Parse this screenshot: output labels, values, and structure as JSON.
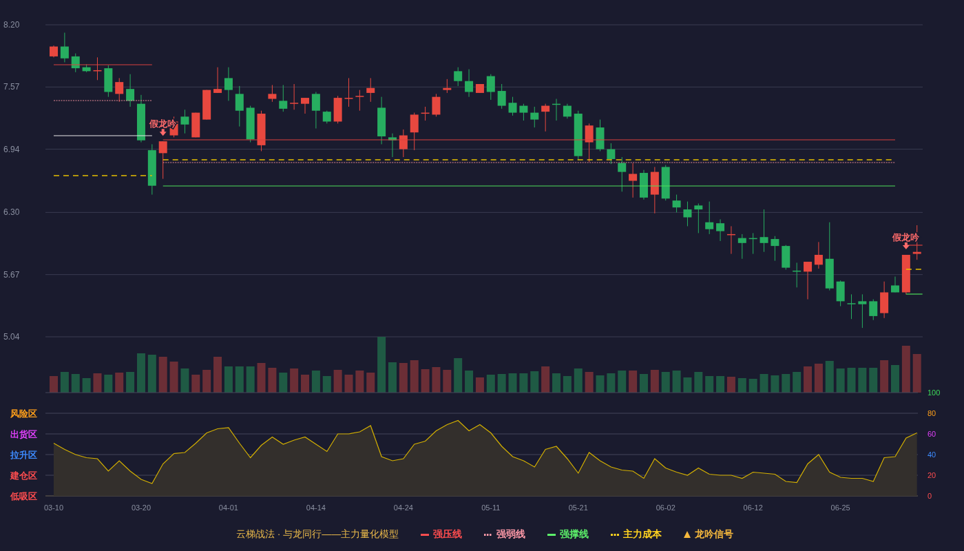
{
  "price_chart": {
    "chart_data": {
      "type": "candlestick",
      "grid": true,
      "ylim": [
        5.04,
        8.2
      ],
      "yticks": [
        {
          "value": 8.2,
          "label": "8.20"
        },
        {
          "value": 7.57,
          "label": "7.57"
        },
        {
          "value": 6.94,
          "label": "6.94"
        },
        {
          "value": 6.3,
          "label": "6.30"
        },
        {
          "value": 5.67,
          "label": "5.67"
        },
        {
          "value": 5.04,
          "label": "5.04"
        }
      ],
      "ohlc": [
        [
          7.88,
          7.99,
          7.87,
          7.98
        ],
        [
          7.98,
          8.12,
          7.82,
          7.86
        ],
        [
          7.88,
          7.91,
          7.72,
          7.76
        ],
        [
          7.77,
          7.8,
          7.72,
          7.73
        ],
        [
          7.73,
          7.87,
          7.64,
          7.74
        ],
        [
          7.76,
          7.79,
          7.47,
          7.52
        ],
        [
          7.5,
          7.66,
          7.42,
          7.62
        ],
        [
          7.55,
          7.7,
          7.37,
          7.43
        ],
        [
          7.4,
          7.49,
          7.01,
          7.03
        ],
        [
          6.93,
          6.99,
          6.48,
          6.57
        ],
        [
          6.9,
          7.02,
          6.64,
          7.02
        ],
        [
          7.08,
          7.27,
          7.06,
          7.22
        ],
        [
          7.27,
          7.34,
          7.1,
          7.19
        ],
        [
          7.06,
          7.31,
          7.06,
          7.31
        ],
        [
          7.24,
          7.54,
          7.24,
          7.54
        ],
        [
          7.51,
          7.77,
          7.51,
          7.55
        ],
        [
          7.66,
          7.77,
          7.43,
          7.54
        ],
        [
          7.5,
          7.58,
          7.17,
          7.33
        ],
        [
          7.36,
          7.38,
          7.01,
          7.04
        ],
        [
          6.98,
          7.33,
          6.92,
          7.3
        ],
        [
          7.45,
          7.59,
          7.42,
          7.5
        ],
        [
          7.43,
          7.59,
          7.32,
          7.35
        ],
        [
          7.4,
          7.6,
          7.34,
          7.41
        ],
        [
          7.4,
          7.46,
          7.3,
          7.46
        ],
        [
          7.5,
          7.52,
          7.15,
          7.33
        ],
        [
          7.32,
          7.33,
          7.2,
          7.22
        ],
        [
          7.22,
          7.48,
          7.2,
          7.46
        ],
        [
          7.45,
          7.66,
          7.37,
          7.46
        ],
        [
          7.47,
          7.54,
          7.33,
          7.48
        ],
        [
          7.51,
          7.66,
          7.42,
          7.56
        ],
        [
          7.36,
          7.47,
          6.99,
          7.07
        ],
        [
          7.06,
          7.1,
          6.86,
          7.03
        ],
        [
          6.94,
          7.14,
          6.86,
          7.08
        ],
        [
          7.11,
          7.31,
          6.93,
          7.29
        ],
        [
          7.3,
          7.37,
          7.23,
          7.31
        ],
        [
          7.29,
          7.5,
          7.27,
          7.47
        ],
        [
          7.54,
          7.65,
          7.51,
          7.56
        ],
        [
          7.73,
          7.77,
          7.58,
          7.63
        ],
        [
          7.63,
          7.75,
          7.47,
          7.52
        ],
        [
          7.51,
          7.6,
          7.51,
          7.6
        ],
        [
          7.68,
          7.7,
          7.44,
          7.52
        ],
        [
          7.53,
          7.6,
          7.35,
          7.38
        ],
        [
          7.41,
          7.47,
          7.28,
          7.31
        ],
        [
          7.38,
          7.4,
          7.23,
          7.31
        ],
        [
          7.31,
          7.37,
          7.16,
          7.24
        ],
        [
          7.32,
          7.4,
          7.12,
          7.38
        ],
        [
          7.4,
          7.45,
          7.23,
          7.39
        ],
        [
          7.38,
          7.4,
          7.25,
          7.27
        ],
        [
          7.3,
          7.33,
          6.83,
          6.87
        ],
        [
          7.01,
          7.2,
          6.81,
          7.18
        ],
        [
          7.16,
          7.24,
          6.92,
          6.94
        ],
        [
          6.94,
          7.0,
          6.79,
          6.84
        ],
        [
          6.8,
          6.86,
          6.51,
          6.71
        ],
        [
          6.62,
          6.8,
          6.45,
          6.69
        ],
        [
          6.7,
          6.73,
          6.43,
          6.45
        ],
        [
          6.48,
          6.76,
          6.29,
          6.71
        ],
        [
          6.76,
          6.78,
          6.42,
          6.44
        ],
        [
          6.42,
          6.48,
          6.3,
          6.35
        ],
        [
          6.33,
          6.41,
          6.16,
          6.25
        ],
        [
          6.37,
          6.39,
          6.09,
          6.33
        ],
        [
          6.2,
          6.41,
          6.08,
          6.13
        ],
        [
          6.19,
          6.23,
          6.01,
          6.11
        ],
        [
          6.07,
          6.16,
          5.88,
          6.08
        ],
        [
          6.04,
          6.08,
          5.83,
          5.99
        ],
        [
          6.04,
          6.09,
          5.88,
          6.03
        ],
        [
          6.05,
          6.33,
          5.9,
          5.99
        ],
        [
          6.03,
          6.06,
          5.81,
          5.96
        ],
        [
          5.96,
          5.97,
          5.72,
          5.74
        ],
        [
          5.71,
          5.79,
          5.54,
          5.7
        ],
        [
          5.7,
          5.8,
          5.42,
          5.8
        ],
        [
          5.77,
          6.0,
          5.73,
          5.87
        ],
        [
          5.83,
          6.2,
          5.51,
          5.53
        ],
        [
          5.6,
          5.61,
          5.35,
          5.4
        ],
        [
          5.38,
          5.47,
          5.22,
          5.37
        ],
        [
          5.4,
          5.47,
          5.13,
          5.37
        ],
        [
          5.4,
          5.42,
          5.21,
          5.25
        ],
        [
          5.28,
          5.6,
          5.23,
          5.49
        ],
        [
          5.56,
          5.65,
          5.49,
          5.49
        ],
        [
          5.49,
          5.87,
          5.47,
          5.87
        ],
        [
          5.88,
          6.17,
          5.82,
          5.9
        ]
      ]
    },
    "signals": [
      {
        "label": "假龙吟"
      },
      {
        "label": "假龙吟"
      }
    ]
  },
  "oscillator": {
    "zones": [
      {
        "label": "风险区",
        "color": "#ff9f1a"
      },
      {
        "label": "出货区",
        "color": "#e040fb"
      },
      {
        "label": "拉升区",
        "color": "#3d8bff"
      },
      {
        "label": "建仓区",
        "color": "#ff4d4f"
      },
      {
        "label": "低吸区",
        "color": "#ff4d4f"
      }
    ],
    "chart_data": {
      "type": "area",
      "grid": true,
      "ylim": [
        0,
        100
      ],
      "yticks": [
        {
          "value": 100,
          "label": "100"
        },
        {
          "value": 80,
          "label": "80"
        },
        {
          "value": 60,
          "label": "60"
        },
        {
          "value": 40,
          "label": "40"
        },
        {
          "value": 20,
          "label": "20"
        },
        {
          "value": 0,
          "label": "0"
        }
      ],
      "categories": [
        "03-10",
        null,
        null,
        null,
        null,
        null,
        null,
        null,
        "03-20",
        null,
        null,
        null,
        null,
        null,
        null,
        null,
        "04-01",
        null,
        null,
        null,
        null,
        null,
        null,
        null,
        "04-14",
        null,
        null,
        null,
        null,
        null,
        null,
        null,
        "04-24",
        null,
        null,
        null,
        null,
        null,
        null,
        null,
        "05-11",
        null,
        null,
        null,
        null,
        null,
        null,
        null,
        "05-21",
        null,
        null,
        null,
        null,
        null,
        null,
        null,
        "06-02",
        null,
        null,
        null,
        null,
        null,
        null,
        null,
        "06-12",
        null,
        null,
        null,
        null,
        null,
        null,
        null,
        "06-25",
        null,
        null,
        null,
        null,
        null,
        null,
        null
      ],
      "values": [
        51,
        45,
        40,
        37,
        36,
        24,
        34,
        24,
        16,
        12,
        31,
        41,
        42,
        51,
        61,
        65,
        66,
        51,
        37,
        49,
        57,
        50,
        54,
        57,
        50,
        43,
        60,
        60,
        62,
        68,
        38,
        34,
        36,
        50,
        53,
        63,
        69,
        73,
        63,
        69,
        61,
        48,
        38,
        34,
        28,
        45,
        48,
        36,
        22,
        42,
        34,
        28,
        25,
        24,
        17,
        36,
        27,
        23,
        20,
        27,
        21,
        20,
        20,
        17,
        23,
        22,
        21,
        14,
        13,
        31,
        40,
        23,
        18,
        17,
        17,
        14,
        37,
        38,
        56,
        61
      ]
    }
  },
  "legend": {
    "title": "云梯战法 · 与龙同行——主力量化模型",
    "items": [
      {
        "kind": "resistance",
        "label": "强压线",
        "color": "#ff4d4f"
      },
      {
        "kind": "weak",
        "label": "强弱线",
        "color": "#ff9aa8"
      },
      {
        "kind": "support",
        "label": "强撑线",
        "color": "#5cf06a"
      },
      {
        "kind": "cost",
        "label": "主力成本",
        "color": "#ffd21f"
      },
      {
        "kind": "signal",
        "label": "龙吟信号",
        "color": "#f5b83d"
      }
    ]
  }
}
